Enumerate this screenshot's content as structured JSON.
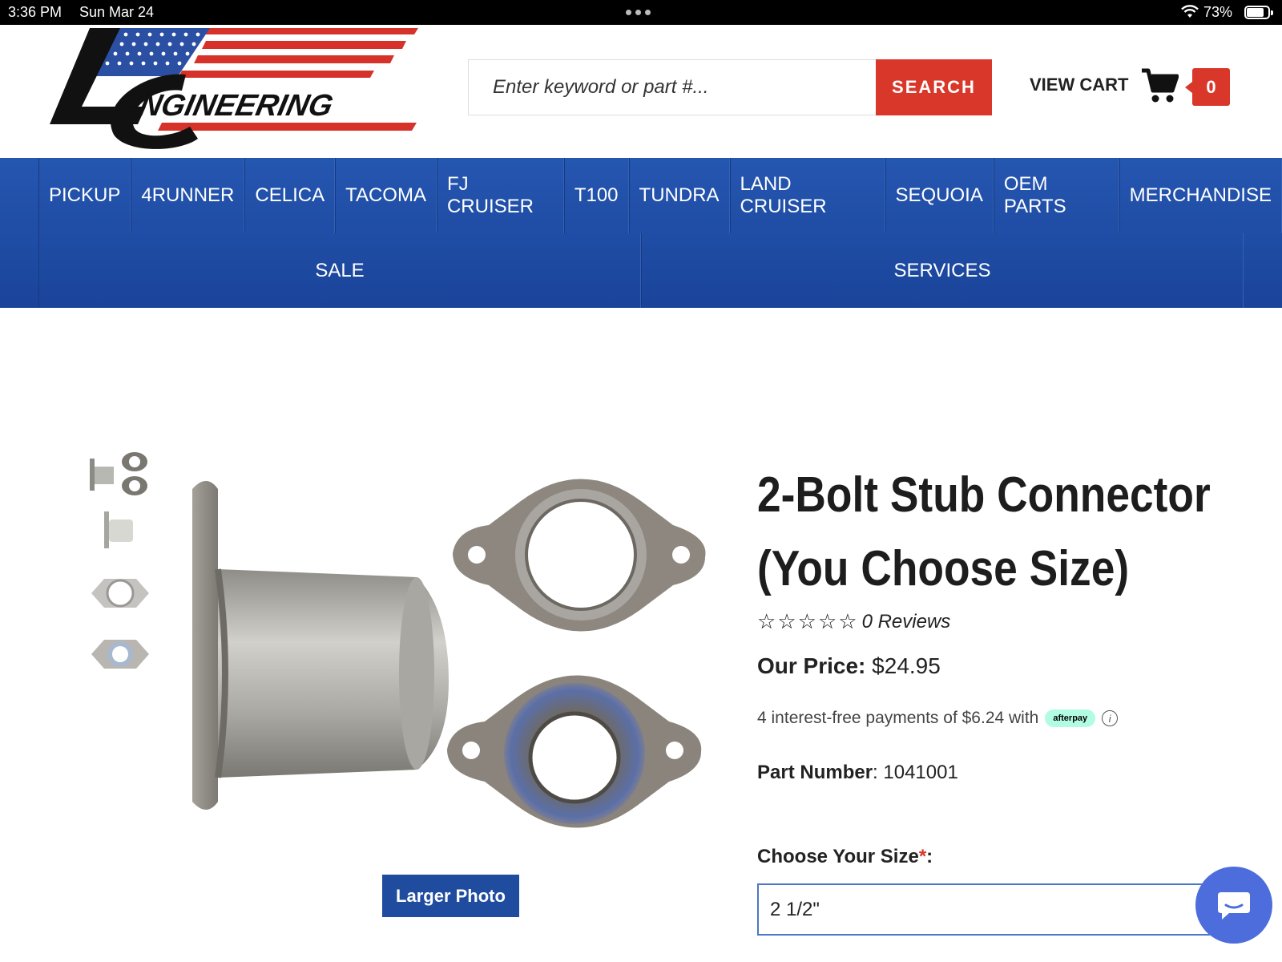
{
  "status_bar": {
    "time": "3:36 PM",
    "date": "Sun Mar 24",
    "battery_percent": "73%"
  },
  "header": {
    "logo_text": "LC ENGINEERING",
    "search_placeholder": "Enter keyword or part #...",
    "search_button": "SEARCH",
    "view_cart": "VIEW CART",
    "cart_count": "0"
  },
  "nav": {
    "row1": [
      "PICKUP",
      "4RUNNER",
      "CELICA",
      "TACOMA",
      "FJ CRUISER",
      "T100",
      "TUNDRA",
      "LAND CRUISER",
      "SEQUOIA",
      "OEM PARTS",
      "MERCHANDISE"
    ],
    "row2": [
      "SALE",
      "SERVICES"
    ]
  },
  "gallery": {
    "larger_photo_button": "Larger Photo",
    "thumbnail_count": 4
  },
  "product": {
    "title_line1": "2-Bolt Stub Connector",
    "title_line2": "(You Choose Size)",
    "rating": 0,
    "reviews": "0 Reviews",
    "price_label": "Our Price:",
    "price": "$24.95",
    "afterpay_text": "4 interest-free payments of $6.24 with",
    "afterpay_badge": "afterpay",
    "part_number_label": "Part Number",
    "part_number": "1041001",
    "size_label": "Choose Your Size",
    "size_required_mark": "*",
    "size_value": "2 1/2\""
  },
  "colors": {
    "nav_blue": "#2556b0",
    "accent_red": "#d9372a",
    "chat_blue": "#4c6ddb",
    "afterpay_mint": "#b2fce4"
  }
}
